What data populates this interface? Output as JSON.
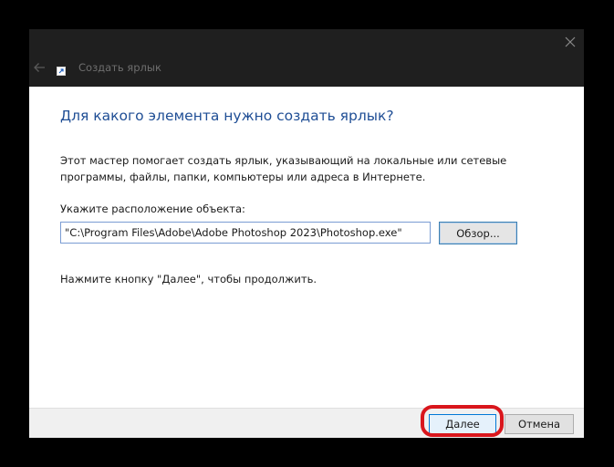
{
  "window": {
    "title": "Создать ярлык",
    "close_icon": "close-icon",
    "back_icon": "arrow-left-icon",
    "app_icon": "shortcut-icon"
  },
  "wizard": {
    "heading": "Для какого элемента нужно создать ярлык?",
    "description": "Этот мастер помогает создать ярлык, указывающий на локальные или сетевые программы, файлы, папки, компьютеры или адреса в Интернете.",
    "location_label": "Укажите расположение объекта:",
    "location_value": "\"C:\\Program Files\\Adobe\\Adobe Photoshop 2023\\Photoshop.exe\"",
    "browse_label": "Обзор...",
    "hint": "Нажмите кнопку \"Далее\", чтобы продолжить."
  },
  "footer": {
    "next_label": "Далее",
    "cancel_label": "Отмена"
  },
  "colors": {
    "titlebar": "#1f1f1f",
    "heading": "#1f4e95",
    "highlight": "#d9161c",
    "accent": "#0078d7"
  }
}
